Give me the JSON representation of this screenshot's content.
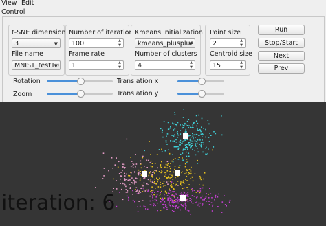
{
  "menubar": {
    "items": [
      "View",
      "Edit"
    ]
  },
  "control_title": "Control",
  "tsne": {
    "dimension_label": "t-SNE dimension",
    "dimension_value": "3",
    "file_label": "File name",
    "file_value": "MNIST_test10"
  },
  "iteration": {
    "count_label": "Number of iteration",
    "count_value": "100",
    "rate_label": "Frame rate",
    "rate_value": "1"
  },
  "kmeans": {
    "init_label": "Kmeans initialization",
    "init_value": "kmeans_plusplus",
    "clusters_label": "Number of clusters",
    "clusters_value": "4"
  },
  "sizes": {
    "point_label": "Point size",
    "point_value": "2",
    "centroid_label": "Centroid size",
    "centroid_value": "15"
  },
  "buttons": {
    "run": "Run",
    "stop_start": "Stop/Start",
    "next": "Next",
    "prev": "Prev"
  },
  "sliders": {
    "rotation": {
      "label": "Rotation",
      "value": 0.5
    },
    "zoom": {
      "label": "Zoom",
      "value": 0.5
    },
    "translation_x": {
      "label": "Translation x",
      "value": 0.5
    },
    "translation_y": {
      "label": "Translation y",
      "value": 0.5
    }
  },
  "canvas": {
    "background": "#353535",
    "iteration_text": "iteration: 6",
    "clusters": [
      {
        "color": "#3fd0d8"
      },
      {
        "color": "#e6c020"
      },
      {
        "color": "#e49cc6"
      },
      {
        "color": "#c33fd0"
      }
    ]
  }
}
